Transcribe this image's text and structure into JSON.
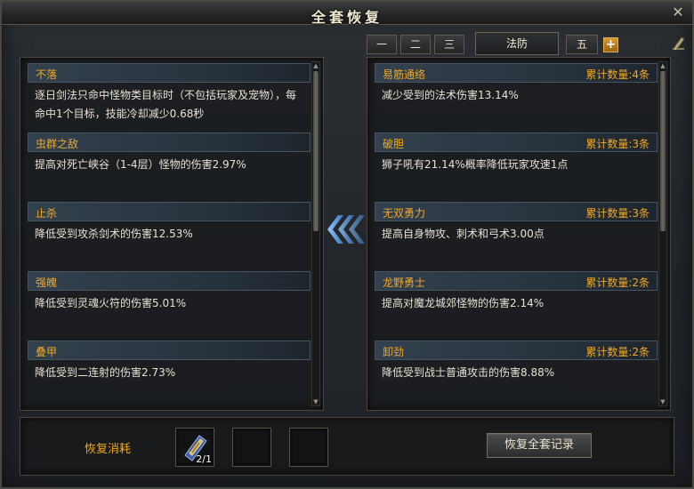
{
  "window": {
    "title": "全套恢复"
  },
  "tabs": [
    {
      "label": "一"
    },
    {
      "label": "二"
    },
    {
      "label": "三"
    },
    {
      "label": "法防"
    },
    {
      "label": "五"
    }
  ],
  "plus_label": "+",
  "left_panel": {
    "entries": [
      {
        "name": "不落",
        "desc": "逐日剑法只命中怪物类目标时（不包括玩家及宠物），每命中1个目标，技能冷却减少0.68秒"
      },
      {
        "name": "虫群之敌",
        "desc": "提高对死亡峡谷（1-4层）怪物的伤害2.97%"
      },
      {
        "name": "止杀",
        "desc": "降低受到攻杀剑术的伤害12.53%"
      },
      {
        "name": "强魄",
        "desc": "降低受到灵魂火符的伤害5.01%"
      },
      {
        "name": "叠甲",
        "desc": "降低受到二连射的伤害2.73%"
      }
    ]
  },
  "right_panel": {
    "entries": [
      {
        "name": "易筋通络",
        "count": "累计数量:4条",
        "desc": "减少受到的法术伤害13.14%"
      },
      {
        "name": "破胆",
        "count": "累计数量:3条",
        "desc": "狮子吼有21.14%概率降低玩家攻速1点"
      },
      {
        "name": "无双勇力",
        "count": "累计数量:3条",
        "desc": "提高自身物攻、刺术和弓术3.00点"
      },
      {
        "name": "龙野勇士",
        "count": "累计数量:2条",
        "desc": "提高对魔龙城郊怪物的伤害2.14%"
      },
      {
        "name": "卸劲",
        "count": "累计数量:2条",
        "desc": "降低受到战士普通攻击的伤害8.88%"
      }
    ]
  },
  "bottom": {
    "cost_label": "恢复消耗",
    "slot_count": "2/1",
    "restore_button": "恢复全套记录"
  },
  "colors": {
    "accent": "#f0a82a",
    "arrow": "#5aa0e6"
  }
}
